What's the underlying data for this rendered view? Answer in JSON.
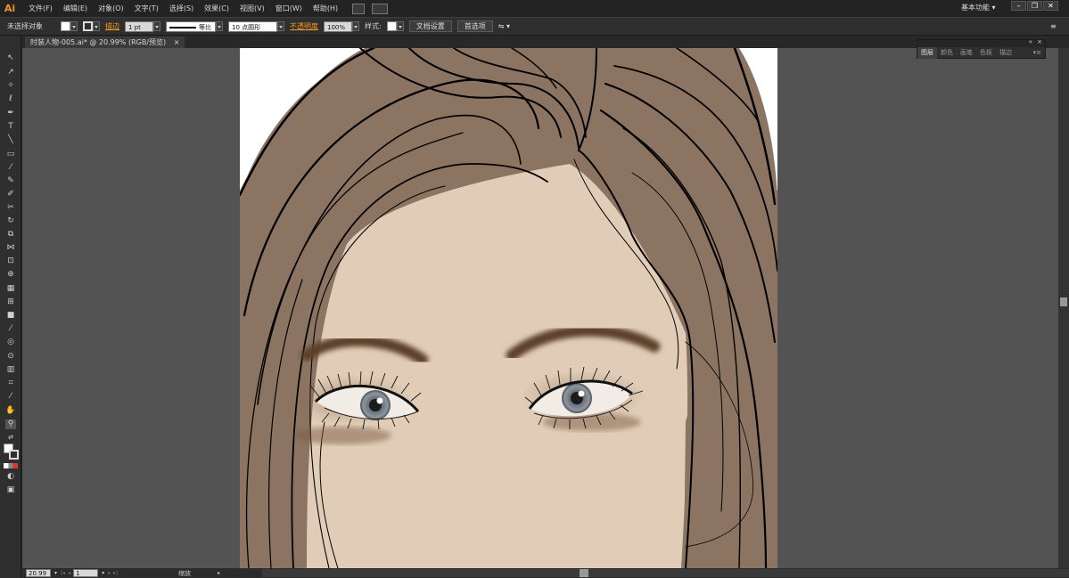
{
  "app": {
    "logo": "Ai",
    "workspace": "基本功能"
  },
  "menu": [
    "文件(F)",
    "编辑(E)",
    "对象(O)",
    "文字(T)",
    "选择(S)",
    "效果(C)",
    "视图(V)",
    "窗口(W)",
    "帮助(H)"
  ],
  "window_buttons": [
    "–",
    "❐",
    "✕"
  ],
  "controlbar": {
    "selection": "未选择对象",
    "stroke_label": "描边",
    "stroke_weight": "1 pt",
    "stroke_profile": "等比",
    "brush": "10 点圆形",
    "opacity_label": "不透明度",
    "opacity_value": "100%",
    "style_label": "样式:",
    "doc_setup_button": "文档设置",
    "preferences_button": "首选项"
  },
  "document_tab": {
    "title": "时装人物-005.ai* @ 20.99% (RGB/预览)",
    "close": "×"
  },
  "panel": {
    "tabs": [
      "图层",
      "颜色",
      "画笔",
      "色板",
      "描边"
    ],
    "active_tab": "图层"
  },
  "statusbar": {
    "zoom": "20.99",
    "artboard": "1",
    "info": "缩放"
  },
  "colors": {
    "accent": "#f79a25",
    "skin": "#e1cdb7",
    "hair": "#8c7462",
    "brow": "#5c3f2b",
    "iris": "#7b838b"
  }
}
